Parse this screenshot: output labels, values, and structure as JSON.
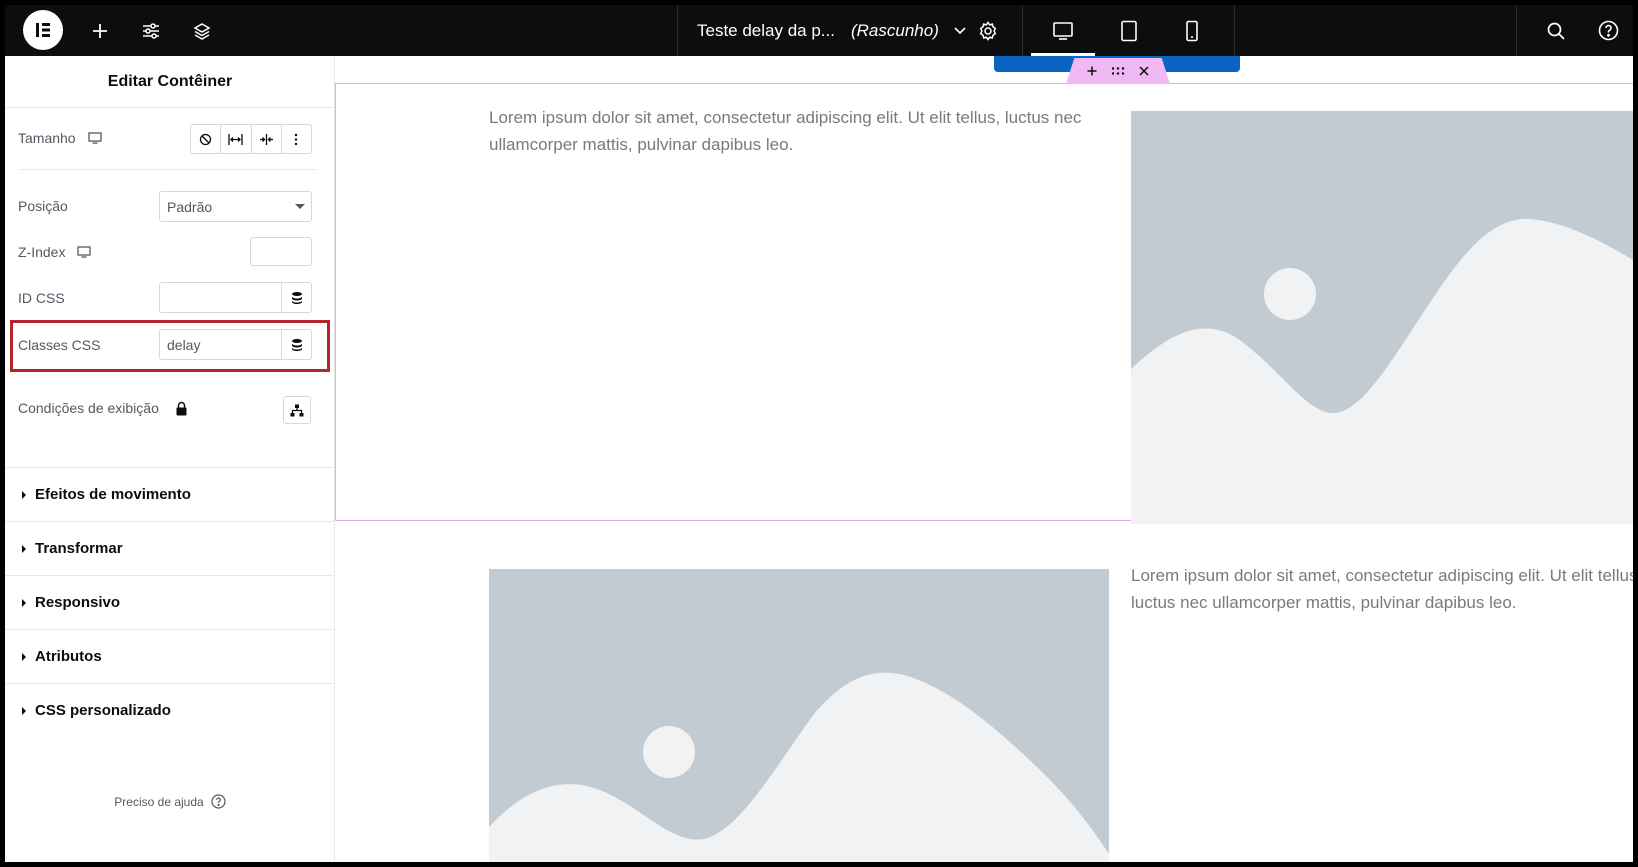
{
  "topbar": {
    "document_title": "Teste delay da p...",
    "document_status": "(Rascunho)",
    "icons": [
      "elementor-logo-icon",
      "plus-icon",
      "sliders-icon",
      "layers-icon",
      "chevron-down-icon",
      "gear-icon",
      "desktop-icon",
      "tablet-icon",
      "mobile-icon",
      "search-icon",
      "help-icon"
    ],
    "active_device": "desktop"
  },
  "panel": {
    "title": "Editar Contêiner",
    "tamanho_label": "Tamanho",
    "posicao_label": "Posição",
    "posicao_value": "Padrão",
    "zindex_label": "Z-Index",
    "zindex_value": "",
    "idcss_label": "ID CSS",
    "idcss_value": "",
    "classes_label": "Classes CSS",
    "classes_value": "delay",
    "condicoes_label": "Condições de exibição",
    "sections": [
      "Efeitos de movimento",
      "Transformar",
      "Responsivo",
      "Atributos",
      "CSS personalizado"
    ],
    "help_text": "Preciso de ajuda"
  },
  "canvas": {
    "lorem_text": "Lorem ipsum dolor sit amet, consectetur adipiscing elit. Ut elit tellus, luctus nec ullamcorper mattis, pulvinar dapibus leo.",
    "lorem_text_2": "Lorem ipsum dolor sit amet, consectetur adipiscing elit. Ut elit tellus, luctus nec ullamcorper mattis, pulvinar dapibus leo."
  },
  "colors": {
    "topbar_bg": "#0c0d0e",
    "highlight_border": "#b3262a",
    "handle_pink": "#f0b8f4",
    "handle_blue": "#0a64c2",
    "placeholder_bg": "#c3cbd2",
    "placeholder_fg": "#f0f2f3"
  }
}
